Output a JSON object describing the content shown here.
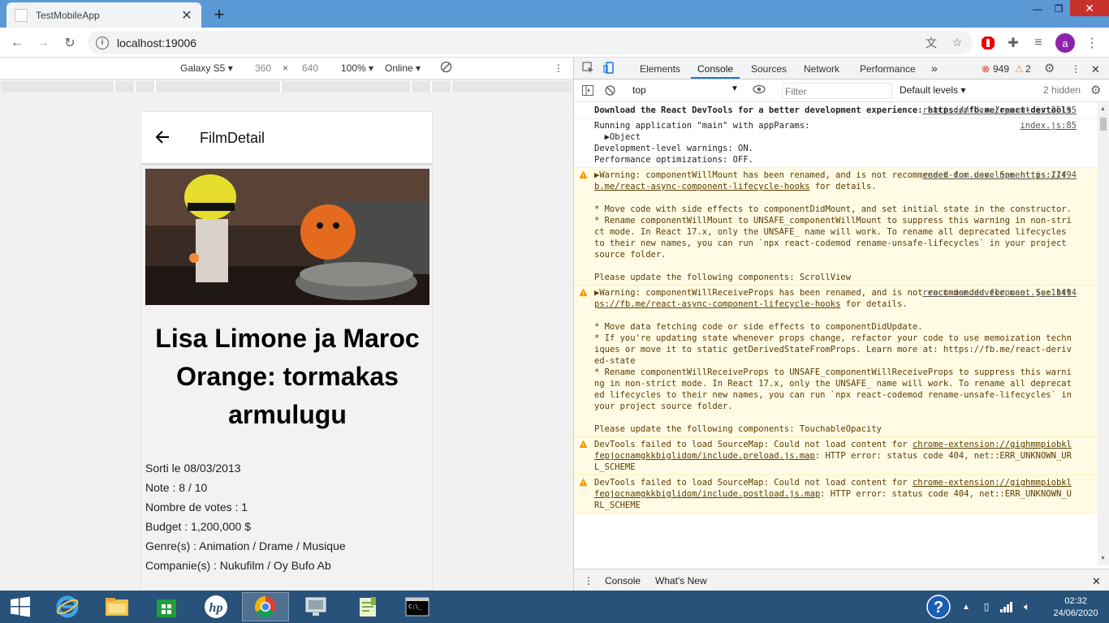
{
  "browser": {
    "tab_title": "TestMobileApp",
    "url": "localhost:19006",
    "avatar_letter": "a"
  },
  "device_bar": {
    "device": "Galaxy S5",
    "width": "360",
    "times": "×",
    "height": "640",
    "zoom": "100%",
    "network": "Online"
  },
  "app": {
    "header_title": "FilmDetail",
    "film_title": "Lisa Limone ja Maroc Orange: tormakas armulugu",
    "release": "Sorti le 08/03/2013",
    "rating": "Note : 8 / 10",
    "votes": "Nombre de votes : 1",
    "budget": "Budget : 1,200,000 $",
    "genres": "Genre(s) : Animation / Drame / Musique",
    "companies": "Companie(s) : Nukufilm / Oy Bufo Ab"
  },
  "devtools": {
    "tabs": [
      "Elements",
      "Console",
      "Sources",
      "Network",
      "Performance"
    ],
    "more": "»",
    "error_count": "949",
    "warning_count": "2",
    "context": "top",
    "filter_placeholder": "Filter",
    "levels": "Default levels",
    "hidden": "2 hidden",
    "messages": [
      {
        "src": "react-dom.development.js:25195",
        "text": "Download the React DevTools for a better development experience: ",
        "link": "https://fb.me/react-devtools",
        "bold": true
      },
      {
        "src": "index.js:85",
        "text": "Running application \"main\" with appParams:\n  ▶Object\nDevelopment-level warnings: ON.\nPerformance optimizations: OFF."
      },
      {
        "src": "react-dom.development.js:11494",
        "warn": true,
        "text": "▶Warning: componentWillMount has been renamed, and is not recommended for use. See ",
        "link": "https://fb.me/react-async-component-lifecycle-hooks",
        "tail": " for details.\n\n* Move code with side effects to componentDidMount, and set initial state in the constructor.\n* Rename componentWillMount to UNSAFE_componentWillMount to suppress this warning in non-strict mode. In React 17.x, only the UNSAFE_ name will work. To rename all deprecated lifecycles to their new names, you can run `npx react-codemod rename-unsafe-lifecycles` in your project source folder.\n\nPlease update the following components: ScrollView"
      },
      {
        "src": "react-dom.development.js:11494",
        "warn": true,
        "text": "▶Warning: componentWillReceiveProps has been renamed, and is not recommended for use. See ",
        "link": "https://fb.me/react-async-component-lifecycle-hooks",
        "tail": " for details.\n\n* Move data fetching code or side effects to componentDidUpdate.\n* If you're updating state whenever props change, refactor your code to use memoization techniques or move it to static getDerivedStateFromProps. Learn more at: https://fb.me/react-derived-state\n* Rename componentWillReceiveProps to UNSAFE_componentWillReceiveProps to suppress this warning in non-strict mode. In React 17.x, only the UNSAFE_ name will work. To rename all deprecated lifecycles to their new names, you can run `npx react-codemod rename-unsafe-lifecycles` in your project source folder.\n\nPlease update the following components: TouchableOpacity"
      },
      {
        "src": "",
        "warn": true,
        "text": "DevTools failed to load SourceMap: Could not load content for ",
        "link": "chrome-extension://gighmmpiobklfepjocnamgkkbiglidom/include.preload.js.map",
        "tail": ": HTTP error: status code 404, net::ERR_UNKNOWN_URL_SCHEME"
      },
      {
        "src": "",
        "warn": true,
        "text": "DevTools failed to load SourceMap: Could not load content for ",
        "link": "chrome-extension://gighmmpiobklfepjocnamgkkbiglidom/include.postload.js.map",
        "tail": ": HTTP error: status code 404, net::ERR_UNKNOWN_URL_SCHEME"
      }
    ],
    "drawer_tabs": [
      "Console",
      "What's New"
    ]
  },
  "taskbar": {
    "time": "02:32",
    "date": "24/06/2020"
  },
  "colors": {
    "titlebar": "#5a98d6",
    "taskbar": "#28527a",
    "accent": "#1a73e8",
    "warning_bg": "#fffbe5",
    "error_red": "#d93025",
    "warning_amber": "#f29900"
  }
}
